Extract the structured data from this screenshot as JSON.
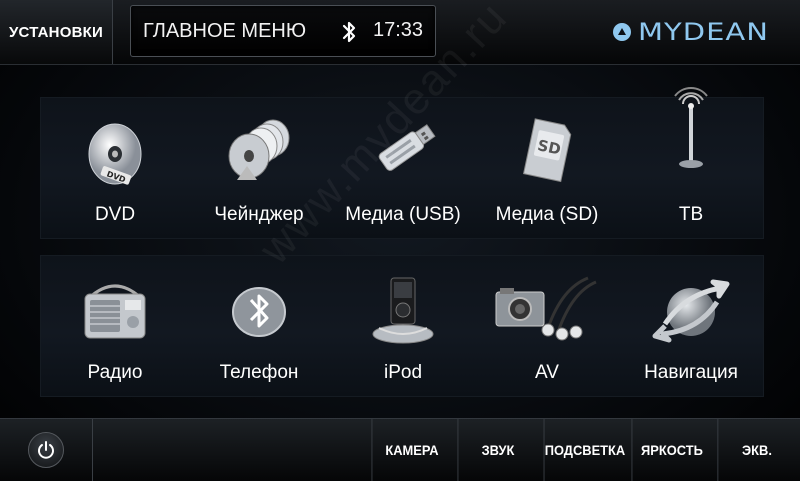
{
  "topbar": {
    "settings_label": "УСТАНОВКИ",
    "title": "ГЛАВНОЕ МЕНЮ",
    "time": "17:33",
    "logo_text": "mydean",
    "accent_color": "#8fc8ef"
  },
  "menu_row_1": [
    {
      "label": "DVD",
      "icon": "dvd-disc-icon"
    },
    {
      "label": "Чейнджер",
      "icon": "disc-changer-icon"
    },
    {
      "label": "Медиа (USB)",
      "icon": "usb-drive-icon"
    },
    {
      "label": "Медиа (SD)",
      "icon": "sd-card-icon"
    },
    {
      "label": "ТВ",
      "icon": "tv-antenna-icon"
    }
  ],
  "menu_row_2": [
    {
      "label": "Радио",
      "icon": "radio-icon"
    },
    {
      "label": "Телефон",
      "icon": "bluetooth-phone-icon"
    },
    {
      "label": "iPod",
      "icon": "ipod-dock-icon"
    },
    {
      "label": "AV",
      "icon": "av-cables-icon"
    },
    {
      "label": "Навигация",
      "icon": "navigation-globe-icon"
    }
  ],
  "bottombar": {
    "camera": "КАМЕРА",
    "sound": "ЗВУК",
    "backlight": "ПОДСВЕТКА",
    "brightness": "ЯРКОСТЬ",
    "eq": "ЭКВ."
  },
  "watermark": "www.mydean.ru"
}
